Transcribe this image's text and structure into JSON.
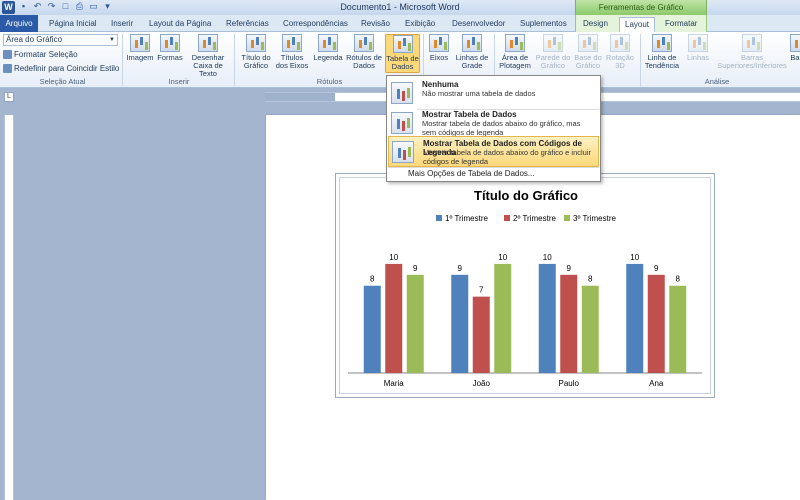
{
  "window": {
    "title": "Documento1 - Microsoft Word",
    "app_icon": "W"
  },
  "context_banner": "Ferramentas de Gráfico",
  "tabs": [
    {
      "label": "Arquivo"
    },
    {
      "label": "Página Inicial"
    },
    {
      "label": "Inserir"
    },
    {
      "label": "Layout da Página"
    },
    {
      "label": "Referências"
    },
    {
      "label": "Correspondências"
    },
    {
      "label": "Revisão"
    },
    {
      "label": "Exibição"
    },
    {
      "label": "Desenvolvedor"
    },
    {
      "label": "Suplementos"
    },
    {
      "label": "Design"
    },
    {
      "label": "Layout"
    },
    {
      "label": "Formatar"
    }
  ],
  "ribbon": {
    "selection_dropdown": "Área do Gráfico",
    "format_selection": "Formatar Seleção",
    "reset_style": "Redefinir para Coincidir Estilo",
    "group_selection": "Seleção Atual",
    "group_insert": "Inserir",
    "group_labels": "Rótulos",
    "group_analysis": "Análise",
    "buttons": {
      "imagem": "Imagem",
      "formas": "Formas",
      "caixa_l1": "Desenhar",
      "caixa_l2": "Caixa de Texto",
      "titulo_l1": "Título do",
      "titulo_l2": "Gráfico",
      "eixos_titulos_l1": "Títulos",
      "eixos_titulos_l2": "dos Eixos",
      "legenda": "Legenda",
      "rotulos_l1": "Rótulos de",
      "rotulos_l2": "Dados",
      "tabela_l1": "Tabela de",
      "tabela_l2": "Dados",
      "eixos": "Eixos",
      "linhas_l1": "Linhas de",
      "linhas_l2": "Grade",
      "area_l1": "Área de",
      "area_l2": "Plotagem",
      "parede_l1": "Parede do",
      "parede_l2": "Gráfico",
      "base_l1": "Base do",
      "base_l2": "Gráfico",
      "rotacao_l1": "Rotação",
      "rotacao_l2": "3D",
      "tendencia_l1": "Linha de",
      "tendencia_l2": "Tendência",
      "linhas2": "Linhas",
      "barras_l1": "Barras",
      "barras_l2": "Superiores/Inferiores",
      "ba_l1": "Ba"
    }
  },
  "menu": {
    "items": [
      {
        "title": "Nenhuma",
        "desc": "Não mostrar uma tabela de dados"
      },
      {
        "title": "Mostrar Tabela de Dados",
        "desc": "Mostrar tabela de dados abaixo do gráfico, mas sem códigos de legenda"
      },
      {
        "title": "Mostrar Tabela de Dados com Códigos de Legenda",
        "desc": "Mostrar tabela de dados abaixo do gráfico e incluir códigos de legenda"
      }
    ],
    "more": "Mais Opções de Tabela de Dados..."
  },
  "colors": {
    "series1": "#4f81bd",
    "series2": "#c0504d",
    "series3": "#9bbb59",
    "accent": "#2a5aa8"
  },
  "chart_data": {
    "type": "bar",
    "title": "Título do Gráfico",
    "categories": [
      "Maria",
      "João",
      "Paulo",
      "Ana"
    ],
    "series": [
      {
        "name": "1º Trimestre",
        "values": [
          8,
          9,
          10,
          10
        ]
      },
      {
        "name": "2º Trimestre",
        "values": [
          10,
          7,
          9,
          9
        ]
      },
      {
        "name": "3º Trimestre",
        "values": [
          9,
          10,
          8,
          8
        ]
      }
    ],
    "ylim": [
      0,
      11
    ],
    "legend": "top",
    "data_labels": true,
    "grid": false
  }
}
